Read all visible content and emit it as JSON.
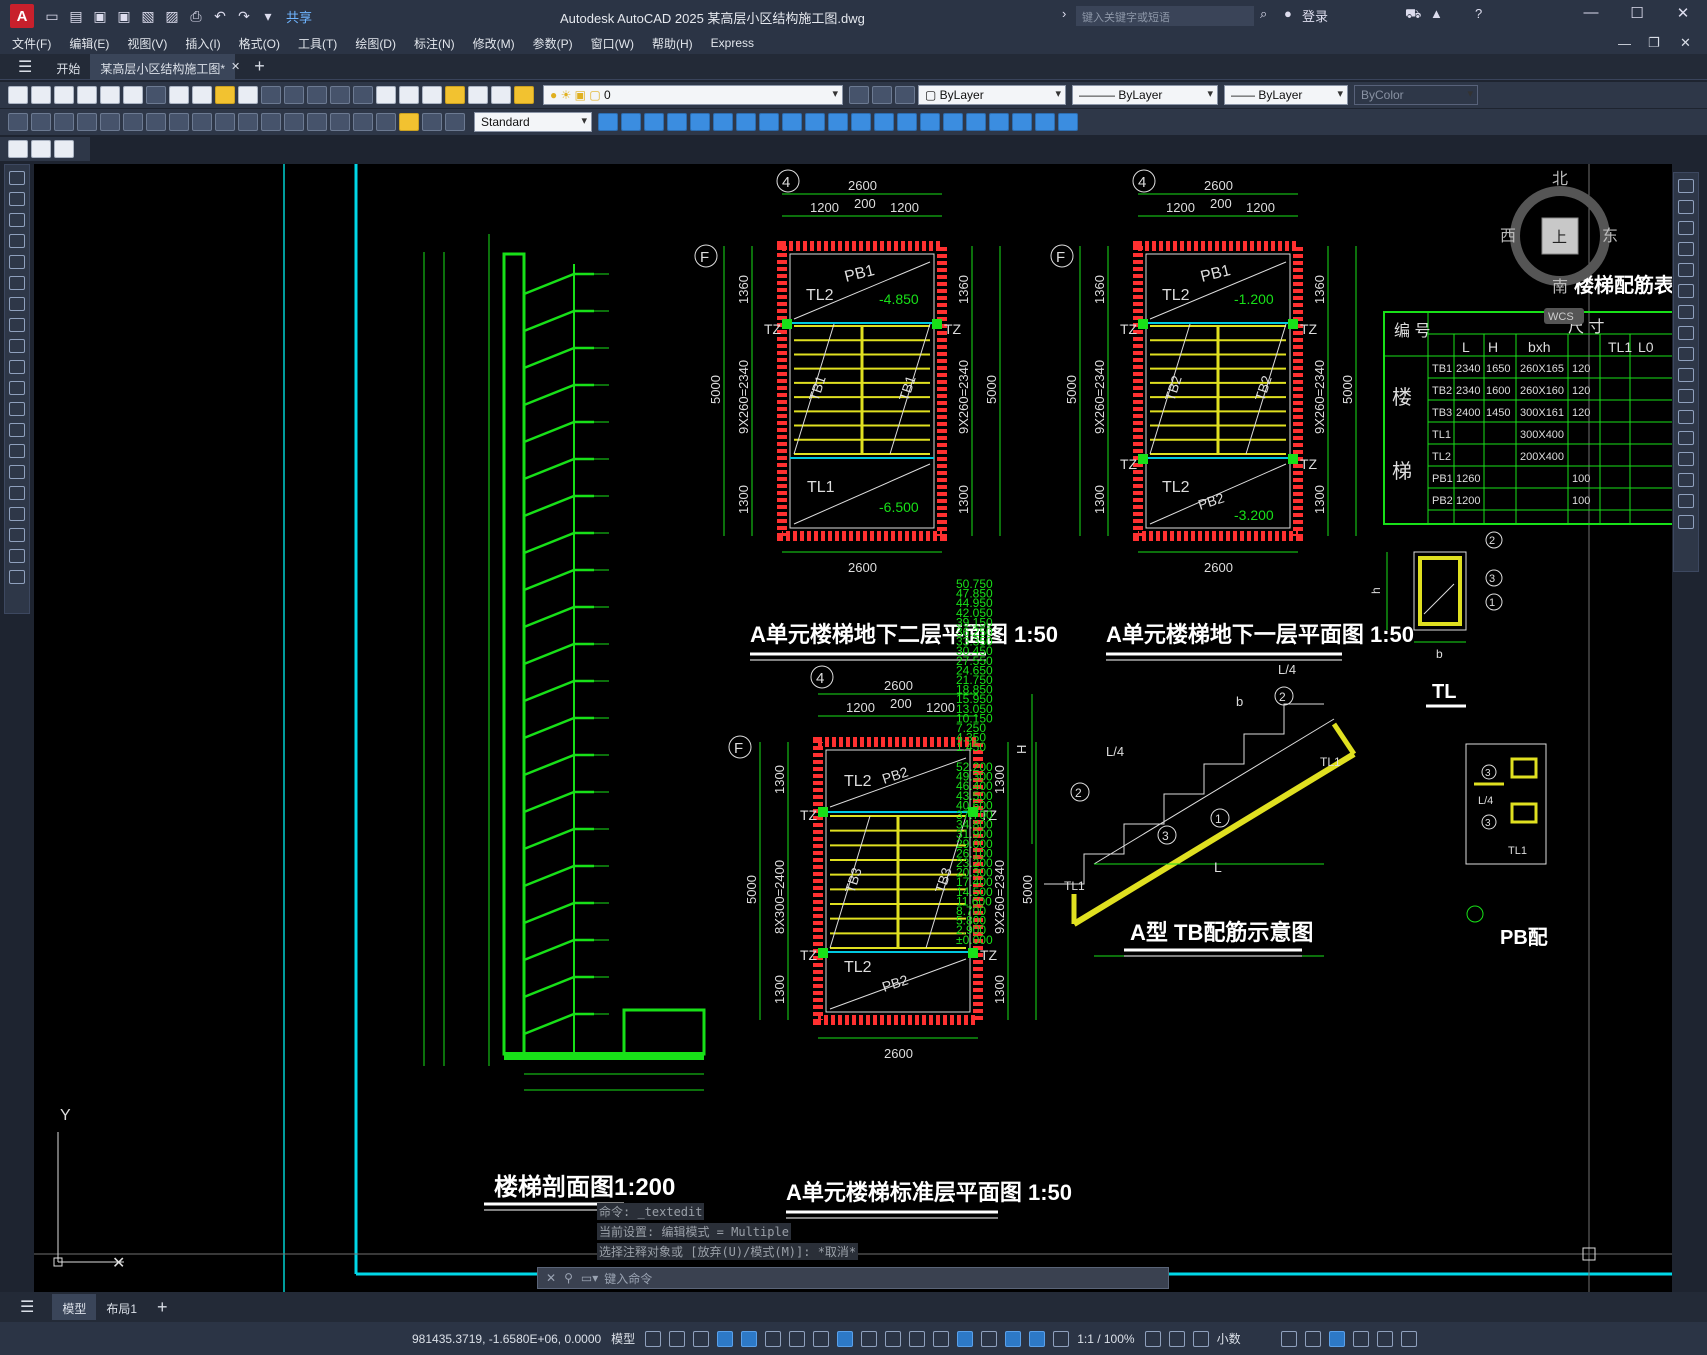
{
  "titlebar": {
    "app_logo": "A",
    "share": "共享",
    "title": "Autodesk AutoCAD 2025    某高层小区结构施工图.dwg",
    "search_placeholder": "键入关键字或短语",
    "login": "登录"
  },
  "menu": [
    "文件(F)",
    "编辑(E)",
    "视图(V)",
    "插入(I)",
    "格式(O)",
    "工具(T)",
    "绘图(D)",
    "标注(N)",
    "修改(M)",
    "参数(P)",
    "窗口(W)",
    "帮助(H)",
    "Express"
  ],
  "tabs": {
    "start": "开始",
    "doc": "某高层小区结构施工图*"
  },
  "properties": {
    "layer": "0",
    "color": "ByLayer",
    "linetype": "ByLayer",
    "lineweight": "ByLayer",
    "plotstyle": "ByColor",
    "textstyle": "Standard"
  },
  "viewcube": {
    "north": "北",
    "south": "南",
    "east": "东",
    "west": "西",
    "face": "上",
    "wcs": "WCS"
  },
  "drawing": {
    "section_title": "楼梯剖面图1:200",
    "plan1_title": "A单元楼梯地下二层平面图 1:50",
    "plan2_title": "A单元楼梯地下一层平面图 1:50",
    "plan3_title": "A单元楼梯标准层平面图 1:50",
    "tb_title": "A型 TB配筋示意图",
    "tl_title": "TL",
    "pb_title": "PB配",
    "table_title": "楼梯配筋表",
    "table_h1": "编 号",
    "table_h2": "尺 寸",
    "table_cols": [
      "L",
      "H",
      "bxh",
      "TL1",
      "L0"
    ],
    "table_group1": "楼",
    "table_group2": "梯",
    "table_rows": [
      [
        "TB1",
        "2340",
        "1650",
        "260X165",
        "120"
      ],
      [
        "TB2",
        "2340",
        "1600",
        "260X160",
        "120"
      ],
      [
        "TB3",
        "2400",
        "1450",
        "300X161",
        "120"
      ],
      [
        "TL1",
        "",
        "",
        "300X400",
        ""
      ],
      [
        "TL2",
        "",
        "",
        "200X400",
        ""
      ],
      [
        "PB1",
        "1260",
        "",
        "",
        "100"
      ],
      [
        "PB2",
        "1200",
        "",
        "",
        "100"
      ]
    ],
    "dims": {
      "d2600": "2600",
      "d1200": "1200",
      "d200": "200",
      "d1360": "1360",
      "d1300": "1300",
      "d5000": "5000",
      "d9x260": "9X260=2340",
      "d8x300": "8X300=2400"
    },
    "labels": {
      "tl1": "TL1",
      "tl2": "TL2",
      "pb1": "PB1",
      "pb2": "PB2",
      "tz": "TZ",
      "tb1": "TB1",
      "tb2": "TB2",
      "tb3": "TB3",
      "e1": "-4.850",
      "e2": "-6.500",
      "e3": "-1.200",
      "e4": "-3.200",
      "axis4": "4",
      "axisF": "F",
      "L": "L",
      "L4": "L/4",
      "H": "H",
      "b": "b",
      "h": "h"
    },
    "elev_a": [
      "50.750",
      "47.850",
      "44.950",
      "42.050",
      "39.150",
      "36.250",
      "33.350",
      "30.450",
      "27.550",
      "24.650",
      "21.750",
      "18.850",
      "15.950",
      "13.050",
      "10.150",
      "7.250",
      "4.350",
      "1.450"
    ],
    "elev_b": [
      "52.200",
      "49.300",
      "46.400",
      "43.500",
      "40.600",
      "37.700",
      "34.800",
      "31.900",
      "29.000",
      "26.100",
      "23.200",
      "20.300",
      "17.400",
      "14.500",
      "11.600",
      "8.700",
      "5.800",
      "2.900",
      "±0.000"
    ],
    "ucs_y": "Y"
  },
  "command": {
    "history": [
      "命令: _textedit",
      "当前设置: 编辑模式 = Multiple",
      "选择注释对象或 [放弃(U)/模式(M)]: *取消*"
    ],
    "placeholder": "键入命令"
  },
  "layout_tabs": {
    "model": "模型",
    "layout1": "布局1"
  },
  "status": {
    "coords": "981435.3719, -1.6580E+06, 0.0000",
    "model": "模型",
    "scale": "1:1 / 100%",
    "units": "小数"
  }
}
